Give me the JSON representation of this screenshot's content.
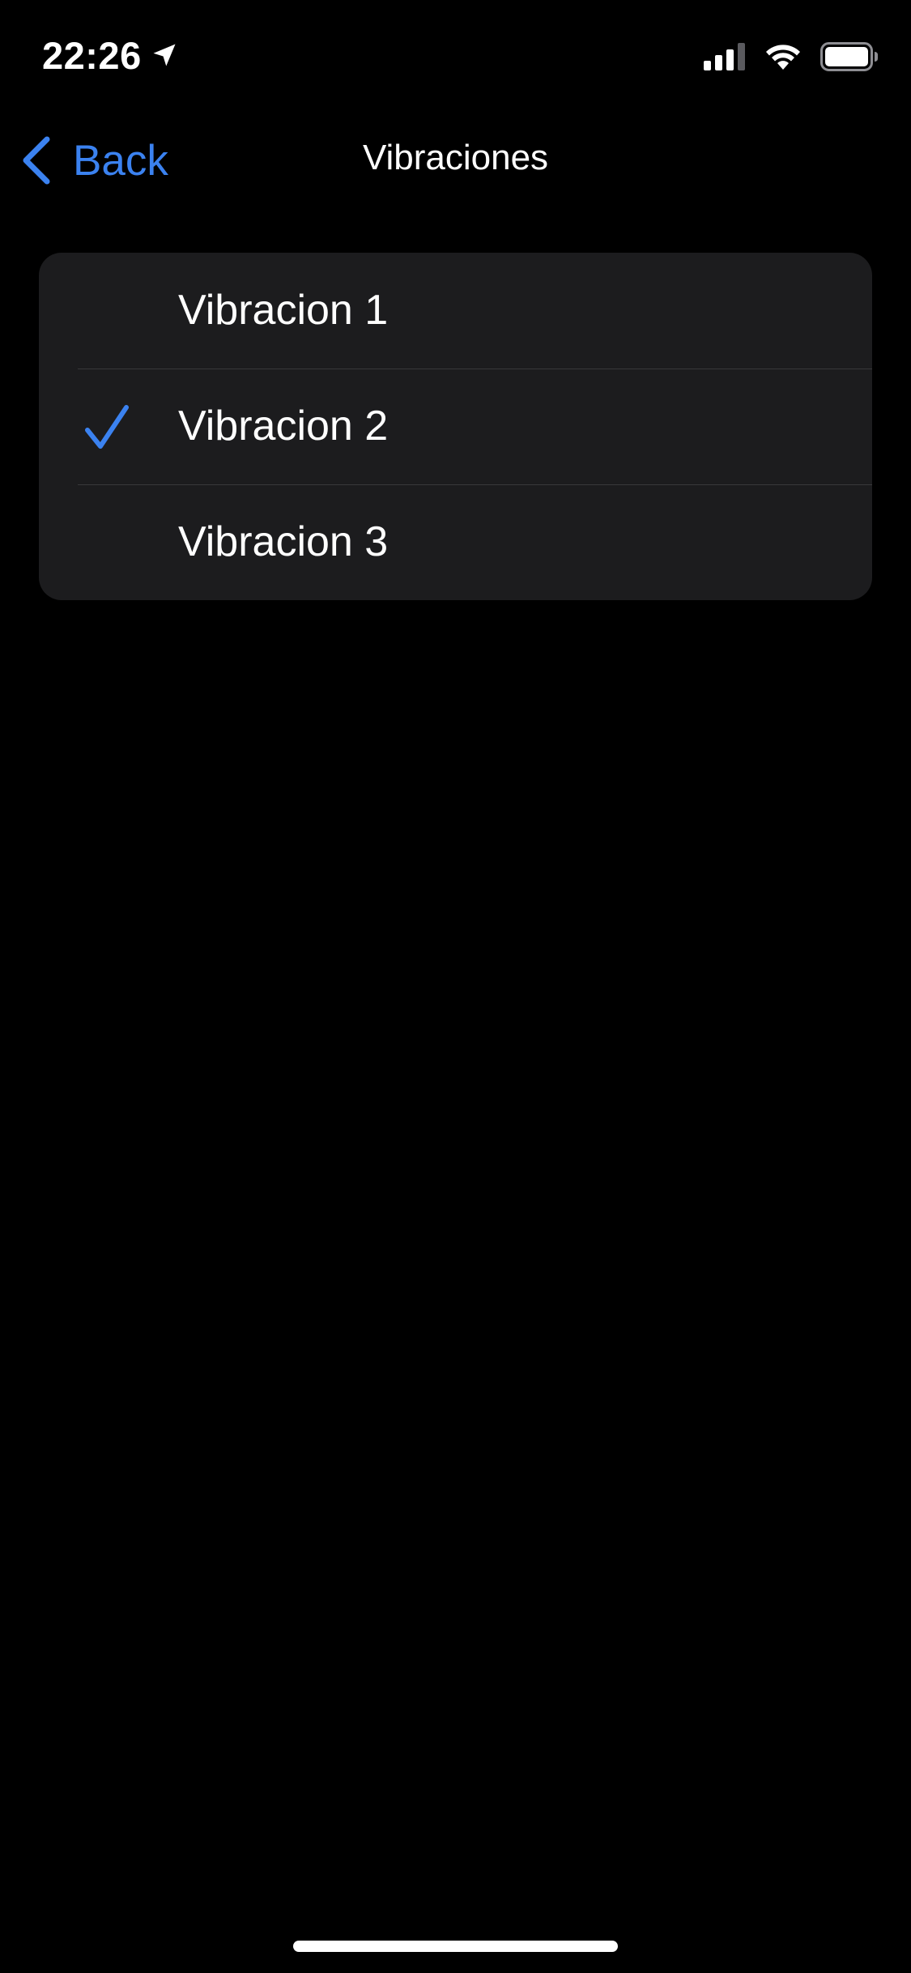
{
  "status_bar": {
    "time": "22:26",
    "icons": [
      "location-arrow-icon",
      "cellular-signal-icon",
      "wifi-icon",
      "battery-icon"
    ]
  },
  "nav": {
    "back_label": "Back",
    "title": "Vibraciones"
  },
  "options": [
    {
      "label": "Vibracion 1",
      "selected": false
    },
    {
      "label": "Vibracion 2",
      "selected": true
    },
    {
      "label": "Vibracion 3",
      "selected": false
    }
  ],
  "colors": {
    "accent": "#3b82f0",
    "background": "#000000",
    "group_background": "#1c1c1e",
    "separator": "#38383a",
    "text": "#ffffff"
  }
}
